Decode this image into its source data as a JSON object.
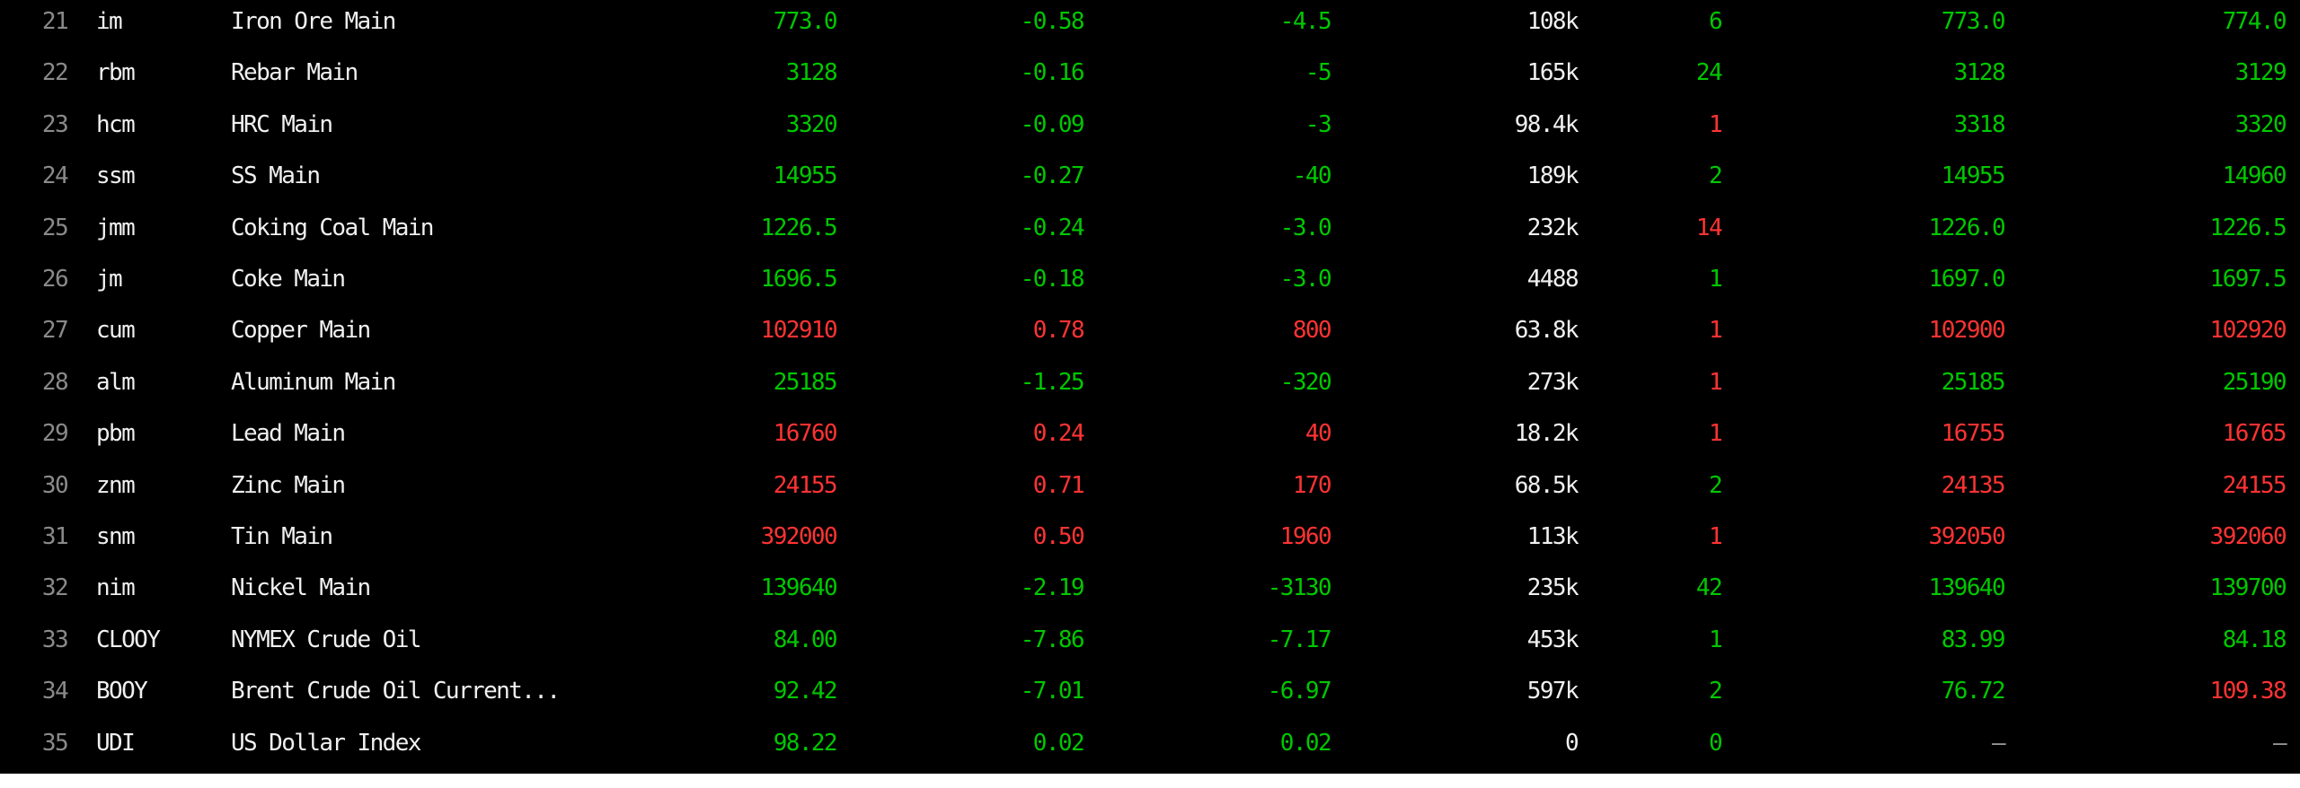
{
  "colors": {
    "up": "#ff3333",
    "down": "#00c800",
    "neutral": "#f0f0f0",
    "muted": "#9a9a9a"
  },
  "rows": [
    {
      "n": "21",
      "code": "im",
      "name": "Iron Ore Main",
      "v": [
        "773.0",
        "-0.58",
        "-4.5",
        "108k",
        "6",
        "773.0",
        "774.0"
      ],
      "c": [
        "g",
        "g",
        "g",
        "w",
        "g",
        "g",
        "g"
      ]
    },
    {
      "n": "22",
      "code": "rbm",
      "name": "Rebar Main",
      "v": [
        "3128",
        "-0.16",
        "-5",
        "165k",
        "24",
        "3128",
        "3129"
      ],
      "c": [
        "g",
        "g",
        "g",
        "w",
        "g",
        "g",
        "g"
      ]
    },
    {
      "n": "23",
      "code": "hcm",
      "name": "HRC Main",
      "v": [
        "3320",
        "-0.09",
        "-3",
        "98.4k",
        "1",
        "3318",
        "3320"
      ],
      "c": [
        "g",
        "g",
        "g",
        "w",
        "r",
        "g",
        "g"
      ]
    },
    {
      "n": "24",
      "code": "ssm",
      "name": "SS Main",
      "v": [
        "14955",
        "-0.27",
        "-40",
        "189k",
        "2",
        "14955",
        "14960"
      ],
      "c": [
        "g",
        "g",
        "g",
        "w",
        "g",
        "g",
        "g"
      ]
    },
    {
      "n": "25",
      "code": "jmm",
      "name": "Coking Coal Main",
      "v": [
        "1226.5",
        "-0.24",
        "-3.0",
        "232k",
        "14",
        "1226.0",
        "1226.5"
      ],
      "c": [
        "g",
        "g",
        "g",
        "w",
        "r",
        "g",
        "g"
      ]
    },
    {
      "n": "26",
      "code": "jm",
      "name": "Coke Main",
      "v": [
        "1696.5",
        "-0.18",
        "-3.0",
        "4488",
        "1",
        "1697.0",
        "1697.5"
      ],
      "c": [
        "g",
        "g",
        "g",
        "w",
        "g",
        "g",
        "g"
      ]
    },
    {
      "n": "27",
      "code": "cum",
      "name": "Copper Main",
      "v": [
        "102910",
        "0.78",
        "800",
        "63.8k",
        "1",
        "102900",
        "102920"
      ],
      "c": [
        "r",
        "r",
        "r",
        "w",
        "r",
        "r",
        "r"
      ]
    },
    {
      "n": "28",
      "code": "alm",
      "name": "Aluminum Main",
      "v": [
        "25185",
        "-1.25",
        "-320",
        "273k",
        "1",
        "25185",
        "25190"
      ],
      "c": [
        "g",
        "g",
        "g",
        "w",
        "r",
        "g",
        "g"
      ]
    },
    {
      "n": "29",
      "code": "pbm",
      "name": "Lead Main",
      "v": [
        "16760",
        "0.24",
        "40",
        "18.2k",
        "1",
        "16755",
        "16765"
      ],
      "c": [
        "r",
        "r",
        "r",
        "w",
        "r",
        "r",
        "r"
      ]
    },
    {
      "n": "30",
      "code": "znm",
      "name": "Zinc Main",
      "v": [
        "24155",
        "0.71",
        "170",
        "68.5k",
        "2",
        "24135",
        "24155"
      ],
      "c": [
        "r",
        "r",
        "r",
        "w",
        "g",
        "r",
        "r"
      ]
    },
    {
      "n": "31",
      "code": "snm",
      "name": "Tin Main",
      "v": [
        "392000",
        "0.50",
        "1960",
        "113k",
        "1",
        "392050",
        "392060"
      ],
      "c": [
        "r",
        "r",
        "r",
        "w",
        "r",
        "r",
        "r"
      ]
    },
    {
      "n": "32",
      "code": "nim",
      "name": "Nickel Main",
      "v": [
        "139640",
        "-2.19",
        "-3130",
        "235k",
        "42",
        "139640",
        "139700"
      ],
      "c": [
        "g",
        "g",
        "g",
        "w",
        "g",
        "g",
        "g"
      ]
    },
    {
      "n": "33",
      "code": "CLOOY",
      "name": "NYMEX Crude Oil",
      "v": [
        "84.00",
        "-7.86",
        "-7.17",
        "453k",
        "1",
        "83.99",
        "84.18"
      ],
      "c": [
        "g",
        "g",
        "g",
        "w",
        "g",
        "g",
        "g"
      ]
    },
    {
      "n": "34",
      "code": "BOOY",
      "name": "Brent Crude Oil Current...",
      "v": [
        "92.42",
        "-7.01",
        "-6.97",
        "597k",
        "2",
        "76.72",
        "109.38"
      ],
      "c": [
        "g",
        "g",
        "g",
        "w",
        "g",
        "g",
        "r"
      ]
    },
    {
      "n": "35",
      "code": "UDI",
      "name": "US Dollar Index",
      "v": [
        "98.22",
        "0.02",
        "0.02",
        "0",
        "0",
        "–",
        "–"
      ],
      "c": [
        "g",
        "g",
        "g",
        "w",
        "g",
        "d",
        "d"
      ]
    }
  ]
}
